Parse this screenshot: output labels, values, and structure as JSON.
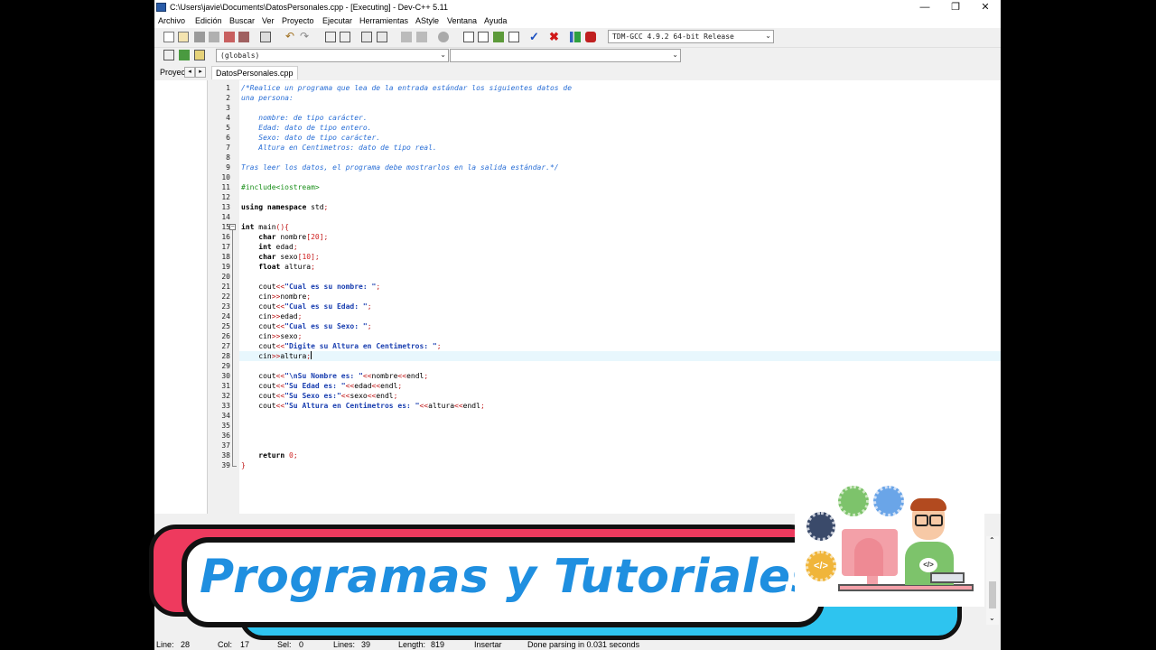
{
  "window": {
    "title": "C:\\Users\\javie\\Documents\\DatosPersonales.cpp - [Executing] - Dev-C++ 5.11",
    "minimize": "—",
    "maximize": "❐",
    "close": "✕"
  },
  "menu": [
    "Archivo",
    "Edición",
    "Buscar",
    "Ver",
    "Proyecto",
    "Ejecutar",
    "Herramientas",
    "AStyle",
    "Ventana",
    "Ayuda"
  ],
  "toolbar": {
    "compiler": "TDM-GCC 4.9.2 64-bit Release",
    "scope": "(globals)",
    "member": ""
  },
  "left_panel": {
    "tab": "Proyec"
  },
  "editor": {
    "file_tab": "DatosPersonales.cpp",
    "current_line": 28,
    "lines": [
      {
        "n": 1,
        "t": "/*Realice un programa que lea de la entrada estándar los siguientes datos de"
      },
      {
        "n": 2,
        "t": "una persona:"
      },
      {
        "n": 3,
        "t": ""
      },
      {
        "n": 4,
        "t": "    nombre: de tipo carácter."
      },
      {
        "n": 5,
        "t": "    Edad: dato de tipo entero."
      },
      {
        "n": 6,
        "t": "    Sexo: dato de tipo carácter."
      },
      {
        "n": 7,
        "t": "    Altura en Centimetros: dato de tipo real."
      },
      {
        "n": 8,
        "t": ""
      },
      {
        "n": 9,
        "t": "Tras leer los datos, el programa debe mostrarlos en la salida estándar.*/"
      },
      {
        "n": 10,
        "t": ""
      },
      {
        "n": 11,
        "t": "#include<iostream>"
      },
      {
        "n": 12,
        "t": ""
      },
      {
        "n": 13,
        "t": "using namespace std;"
      },
      {
        "n": 14,
        "t": ""
      },
      {
        "n": 15,
        "t": "int main(){"
      },
      {
        "n": 16,
        "t": "    char nombre[20];"
      },
      {
        "n": 17,
        "t": "    int edad;"
      },
      {
        "n": 18,
        "t": "    char sexo[10];"
      },
      {
        "n": 19,
        "t": "    float altura;"
      },
      {
        "n": 20,
        "t": ""
      },
      {
        "n": 21,
        "t": "    cout<<\"Cual es su nombre: \";"
      },
      {
        "n": 22,
        "t": "    cin>>nombre;"
      },
      {
        "n": 23,
        "t": "    cout<<\"Cual es su Edad: \";"
      },
      {
        "n": 24,
        "t": "    cin>>edad;"
      },
      {
        "n": 25,
        "t": "    cout<<\"Cual es su Sexo: \";"
      },
      {
        "n": 26,
        "t": "    cin>>sexo;"
      },
      {
        "n": 27,
        "t": "    cout<<\"Digite su Altura en Centimetros: \";"
      },
      {
        "n": 28,
        "t": "    cin>>altura;"
      },
      {
        "n": 29,
        "t": ""
      },
      {
        "n": 30,
        "t": "    cout<<\"\\nSu Nombre es: \"<<nombre<<endl;"
      },
      {
        "n": 31,
        "t": "    cout<<\"Su Edad es: \"<<edad<<endl;"
      },
      {
        "n": 32,
        "t": "    cout<<\"Su Sexo es:\"<<sexo<<endl;"
      },
      {
        "n": 33,
        "t": "    cout<<\"Su Altura en Centimetros es: \"<<altura<<endl;"
      },
      {
        "n": 34,
        "t": ""
      },
      {
        "n": 35,
        "t": ""
      },
      {
        "n": 36,
        "t": ""
      },
      {
        "n": 37,
        "t": ""
      },
      {
        "n": 38,
        "t": "    return 0;"
      },
      {
        "n": 39,
        "t": "}"
      }
    ]
  },
  "status": {
    "line_label": "Line:",
    "line": "28",
    "col_label": "Col:",
    "col": "17",
    "sel_label": "Sel:",
    "sel": "0",
    "lines_label": "Lines:",
    "lines": "39",
    "length_label": "Length:",
    "length": "819",
    "mode": "Insertar",
    "message": "Done parsing in 0.031 seconds"
  },
  "overlay": {
    "banner_text": "Programas y Tutoriales"
  },
  "colors": {
    "comment": "#2a6fd6",
    "preprocessor": "#1a8f1a",
    "string": "#1a3fb0",
    "number": "#d02020",
    "current_line_bg": "#e8f7fd",
    "banner_red": "#ee3a5e",
    "banner_cyan": "#2ec4ef",
    "banner_text": "#1f8fe0"
  }
}
